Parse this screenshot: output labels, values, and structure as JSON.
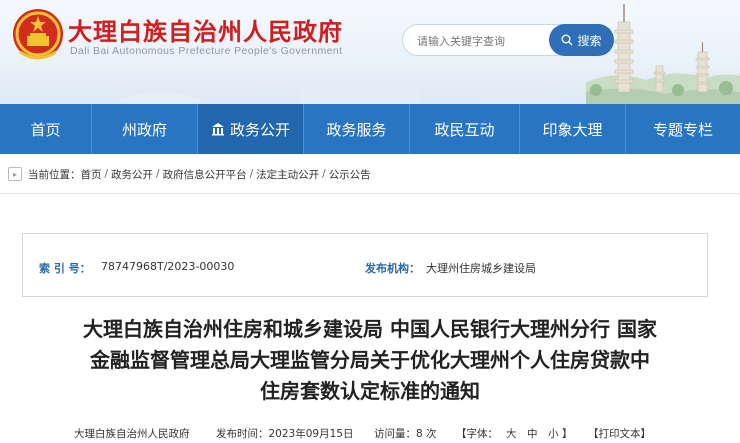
{
  "header": {
    "title": "大理白族自治州人民政府",
    "subtitle": "Dali Bai Autonomous Prefecture People's Government",
    "search": {
      "placeholder": "请输入关键字查询",
      "button_label": "搜索"
    },
    "colors": {
      "title": "#d01d1d",
      "accent": "#2a75c2"
    }
  },
  "nav": {
    "items": [
      {
        "label": "首页"
      },
      {
        "label": "州政府"
      },
      {
        "label": "政务公开",
        "icon": "building-icon",
        "active": true
      },
      {
        "label": "政务服务"
      },
      {
        "label": "政民互动"
      },
      {
        "label": "印象大理"
      },
      {
        "label": "专题专栏"
      }
    ]
  },
  "breadcrumb": {
    "prefix": "当前位置：",
    "items": [
      "首页",
      "政务公开",
      "政府信息公开平台",
      "法定主动公开",
      "公示公告"
    ]
  },
  "info": {
    "index_label": "索 引 号：",
    "index_value": "78747968T/2023-00030",
    "publisher_label": "发布机构：",
    "publisher_value": "大理州住房城乡建设局"
  },
  "article": {
    "title_lines": [
      "大理白族自治州住房和城乡建设局 中国人民银行大理州分行 国家",
      "金融监督管理总局大理监管分局关于优化大理州个人住房贷款中",
      "住房套数认定标准的通知"
    ]
  },
  "meta": {
    "source": "大理白族自治州人民政府",
    "publish_time": "发布时间：2023年09月15日",
    "views": "访问量：8 次",
    "font_prefix": "【字体：",
    "font_large": "大",
    "font_medium": "中",
    "font_small": "小",
    "font_suffix": "】",
    "print": "【打印文本】"
  }
}
